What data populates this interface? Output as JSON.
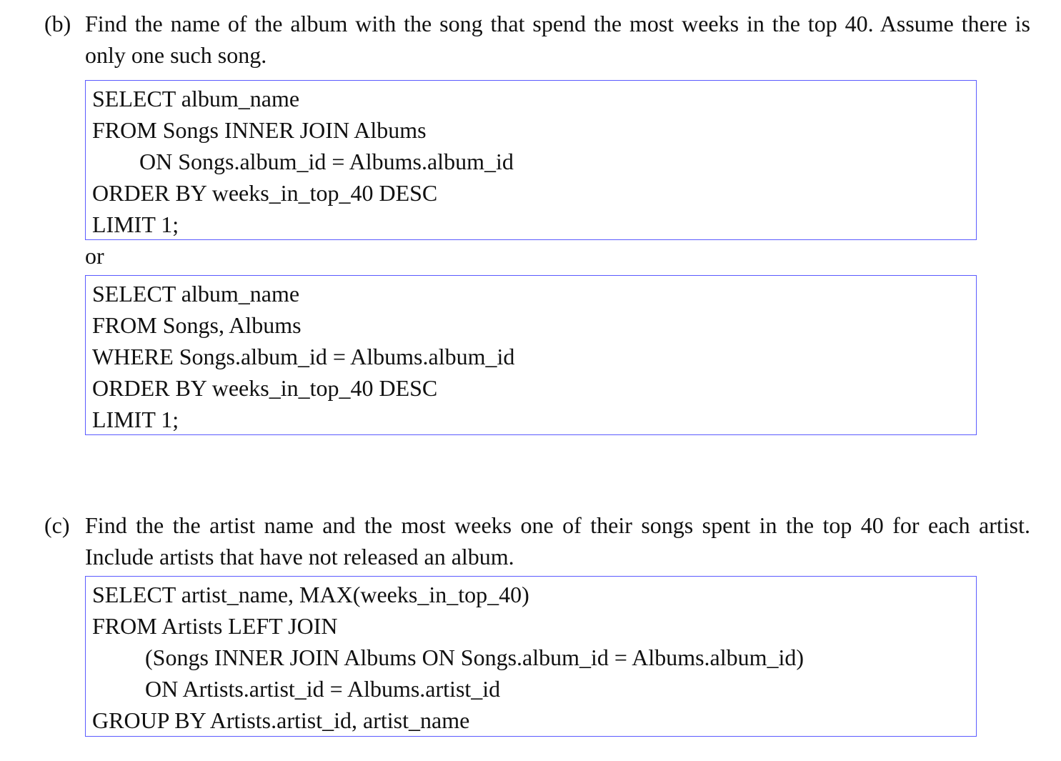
{
  "part_b": {
    "label": "(b)",
    "question": "Find the name of the album with the song that spend the most weeks in the top 40. Assume there is only one such song.",
    "answer_1": [
      "SELECT album_name",
      "FROM Songs INNER JOIN Albums",
      "ON Songs.album_id = Albums.album_id",
      "ORDER BY weeks_in_top_40 DESC",
      "LIMIT 1;"
    ],
    "separator": "or",
    "answer_2": [
      "SELECT album_name",
      "FROM Songs, Albums",
      "WHERE Songs.album_id = Albums.album_id",
      "ORDER BY weeks_in_top_40 DESC",
      "LIMIT 1;"
    ]
  },
  "part_c": {
    "label": "(c)",
    "question": "Find the the artist name and the most weeks one of their songs spent in the top 40 for each artist. Include artists that have not released an album.",
    "answer": [
      "SELECT artist_name, MAX(weeks_in_top_40)",
      "FROM Artists LEFT JOIN",
      "(Songs INNER JOIN Albums ON Songs.album_id = Albums.album_id)",
      "ON Artists.artist_id = Albums.artist_id",
      "GROUP BY Artists.artist_id, artist_name"
    ]
  }
}
